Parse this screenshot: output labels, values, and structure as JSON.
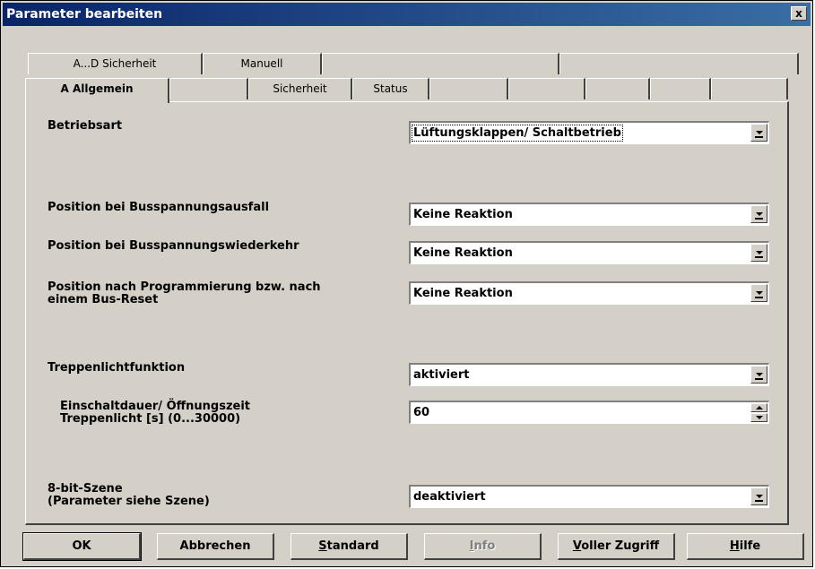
{
  "window": {
    "title": "Parameter bearbeiten",
    "close_glyph": "x"
  },
  "tabs_row1": [
    "A...D  Sicherheit",
    "Manuell"
  ],
  "tabs_row2": [
    "A  Allgemein",
    "Sicherheit",
    "Status"
  ],
  "active_tab": "A  Allgemein",
  "fields": {
    "betriebsart": {
      "label": "Betriebsart",
      "value": "Lüftungsklappen/ Schaltbetrieb"
    },
    "busspannungsausfall": {
      "label": "Position bei Busspannungsausfall",
      "value": "Keine Reaktion"
    },
    "busspannungswiederkehr": {
      "label": "Position bei Busspannungswiederkehr",
      "value": "Keine Reaktion"
    },
    "programmierung": {
      "label_line1": "Position nach Programmierung bzw. nach",
      "label_line2": "einem Bus-Reset",
      "value": "Keine Reaktion"
    },
    "treppenlicht": {
      "label": "Treppenlichtfunktion",
      "value": "aktiviert"
    },
    "einschaltdauer": {
      "label_line1": "Einschaltdauer/ Öffnungszeit",
      "label_line2": "Treppenlicht [s] (0...30000)",
      "value": "60"
    },
    "szene": {
      "label_line1": "8-bit-Szene",
      "label_line2": "(Parameter siehe Szene)",
      "value": "deaktiviert"
    }
  },
  "buttons": {
    "ok": "OK",
    "abbrechen": "Abbrechen",
    "standard_hotkey": "S",
    "standard_rest": "tandard",
    "info_hotkey": "I",
    "info_rest": "nfo",
    "voller_hotkey": "V",
    "voller_rest": "oller Zugriff",
    "hilfe_hotkey": "H",
    "hilfe_rest": "ilfe"
  },
  "colors": {
    "face": "#d4d0c8",
    "title_start": "#0a246a",
    "title_end": "#3a6ea5"
  }
}
